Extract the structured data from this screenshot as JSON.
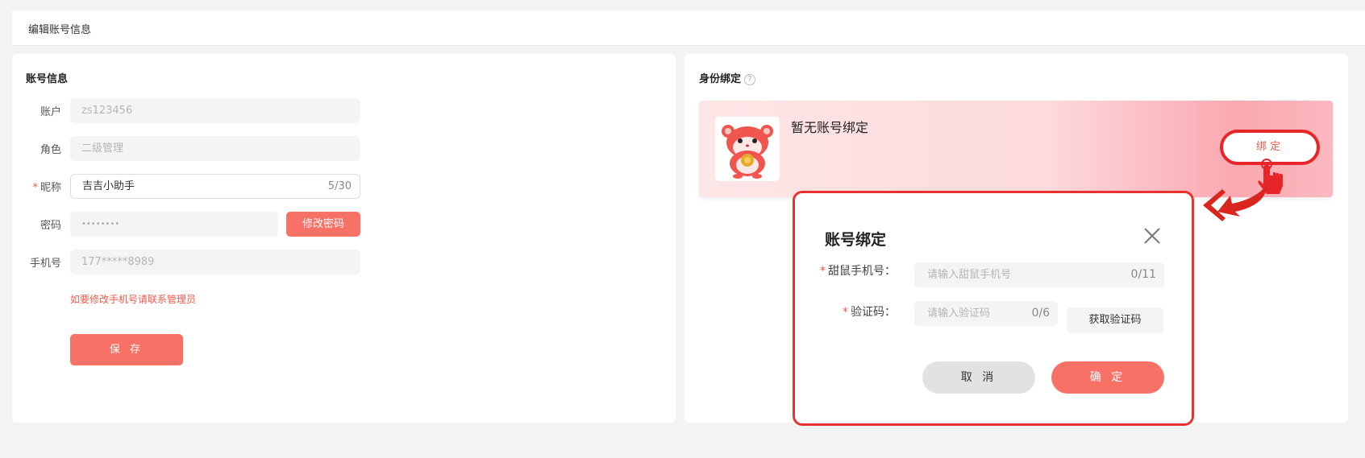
{
  "header": {
    "title": "编辑账号信息"
  },
  "account": {
    "section_title": "账号信息",
    "fields": {
      "account": {
        "label": "账户",
        "value": "zs123456"
      },
      "role": {
        "label": "角色",
        "value": "二级管理"
      },
      "nickname": {
        "label": "昵称",
        "required": "*",
        "value": "吉吉小助手",
        "counter": "5/30"
      },
      "password": {
        "label": "密码",
        "value": "••••••••",
        "button": "修改密码"
      },
      "phone": {
        "label": "手机号",
        "value": "177*****8989"
      }
    },
    "hint": "如要修改手机号请联系管理员",
    "save_button": "保 存"
  },
  "binding": {
    "section_title": "身份绑定",
    "help_glyph": "?",
    "no_binding_text": "暂无账号绑定",
    "bind_button": "绑定"
  },
  "modal": {
    "title": "账号绑定",
    "phone_label": "甜鼠手机号：",
    "phone_placeholder": "请输入甜鼠手机号",
    "phone_counter": "0/11",
    "code_label": "验证码：",
    "code_placeholder": "请输入验证码",
    "code_counter": "0/6",
    "get_code_button": "获取验证码",
    "required": "*",
    "cancel_button": "取 消",
    "confirm_button": "确 定"
  },
  "colors": {
    "accent": "#f87167",
    "highlight": "#e8262a",
    "error": "#f2594b"
  }
}
